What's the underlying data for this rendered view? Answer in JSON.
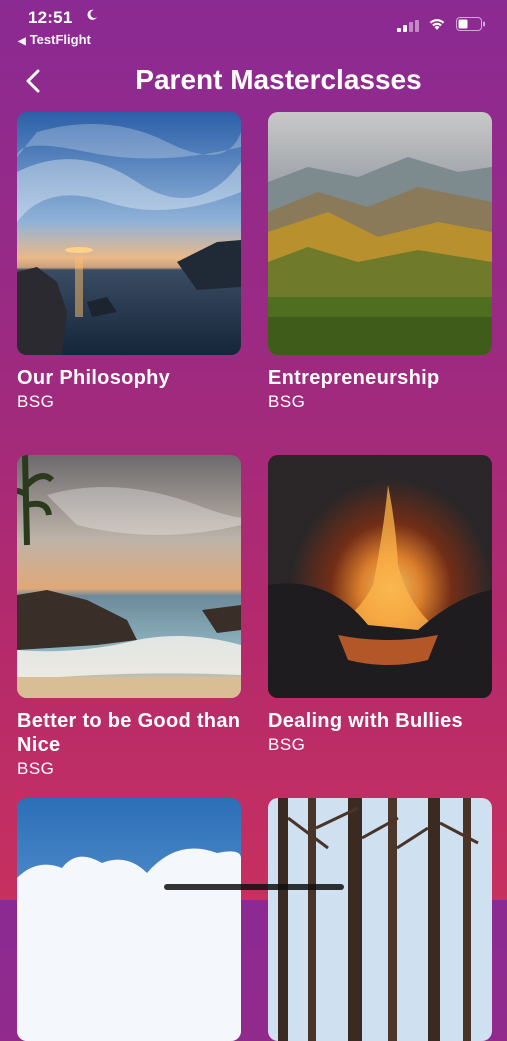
{
  "status_bar": {
    "time": "12:51",
    "back_app": "TestFlight"
  },
  "header": {
    "title": "Parent Masterclasses"
  },
  "cards": [
    {
      "title": "Our Philosophy",
      "subtitle": "BSG",
      "image": "ocean-sunset-image"
    },
    {
      "title": "Entrepreneurship",
      "subtitle": "BSG",
      "image": "mountain-valley-image"
    },
    {
      "title": "Better to be Good than Nice",
      "subtitle": "BSG",
      "image": "beach-shore-image"
    },
    {
      "title": "Dealing with Bullies",
      "subtitle": "BSG",
      "image": "volcano-eruption-image"
    },
    {
      "title": "",
      "subtitle": "",
      "image": "sky-clouds-image"
    },
    {
      "title": "",
      "subtitle": "",
      "image": "forest-trees-image"
    }
  ],
  "colors": {
    "background_top": "#8b2a93",
    "background_bottom": "#c7305f",
    "text": "#ffffff"
  }
}
